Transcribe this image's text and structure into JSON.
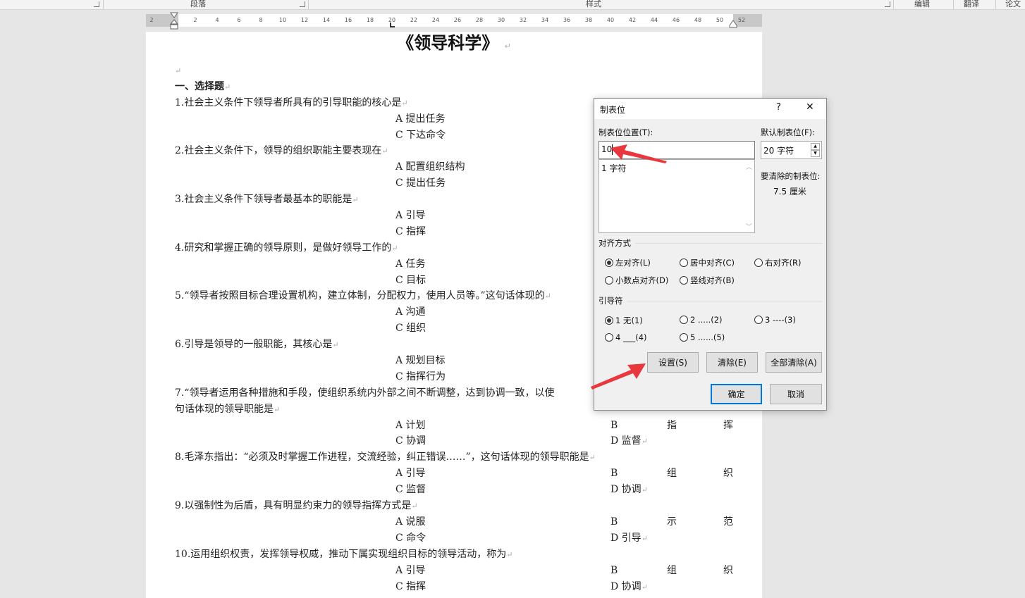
{
  "ribbon": {
    "groups": [
      "段落",
      "样式",
      "编辑",
      "翻译",
      "论文"
    ]
  },
  "ruler": {
    "left_label": "2",
    "ticks": [
      "2",
      "4",
      "6",
      "8",
      "10",
      "12",
      "14",
      "16",
      "18",
      "20",
      "22",
      "24",
      "26",
      "28",
      "30",
      "32",
      "34",
      "36",
      "38",
      "40",
      "42",
      "44",
      "46",
      "48",
      "50",
      "52"
    ]
  },
  "document": {
    "title": "《领导科学》",
    "section": "一、选择题",
    "questions": [
      {
        "text": [
          "1.社会主义条件下领导者所具有的引导职能的核心是"
        ],
        "options": [
          [
            "A 提出任务"
          ],
          [
            "C 下达命令"
          ]
        ]
      },
      {
        "text": [
          "2.社会主义条件下，领导的组织职能主要表现在"
        ],
        "options": [
          [
            "A 配置组织结构"
          ],
          [
            "C 提出任务"
          ]
        ]
      },
      {
        "text": [
          "3.社会主义条件下领导者最基本的职能是"
        ],
        "options": [
          [
            "A 引导"
          ],
          [
            "C 指挥"
          ]
        ]
      },
      {
        "text": [
          "4.研究和掌握正确的领导原则，是做好领导工作的"
        ],
        "options": [
          [
            "A 任务"
          ],
          [
            "C 目标"
          ]
        ]
      },
      {
        "text": [
          "5.“领导者按照目标合理设置机构，建立体制，分配权力，使用人员等。”这句话体现的"
        ],
        "options": [
          [
            "A 沟通"
          ],
          [
            "C 组织"
          ]
        ]
      },
      {
        "text": [
          "6.引导是领导的一般职能，其核心是"
        ],
        "options": [
          [
            "A 规划目标"
          ],
          [
            "C 指挥行为"
          ]
        ]
      },
      {
        "text": [
          "7.“领导者运用各种措施和手段，使组织系统内外部之间不断调整，达到协调一致，以使",
          "句话体现的领导职能是"
        ],
        "options": [
          [
            "A 计划",
            "B",
            "指",
            "挥"
          ],
          [
            "C 协调",
            "D 监督"
          ]
        ]
      },
      {
        "text": [
          "8.毛泽东指出：“必须及时掌握工作进程，交流经验，纠正错误……”，这句话体现的领导职能是"
        ],
        "options": [
          [
            "A 引导",
            "B",
            "组",
            "织"
          ],
          [
            "C 监督",
            "D 协调"
          ]
        ]
      },
      {
        "text": [
          "9.以强制性为后盾，具有明显约束力的领导指挥方式是"
        ],
        "options": [
          [
            "A 说服",
            "B",
            "示",
            "范"
          ],
          [
            "C 命令",
            "D 引导"
          ]
        ]
      },
      {
        "text": [
          "10.运用组织权责，发挥领导权威，推动下属实现组织目标的领导活动，称为"
        ],
        "options": [
          [
            "A 引导",
            "B",
            "组",
            "织"
          ],
          [
            "C 指挥",
            "D 协调"
          ]
        ]
      }
    ]
  },
  "dialog": {
    "title": "制表位",
    "help": "?",
    "close": "✕",
    "position_label": "制表位位置(T):",
    "position_value": "10",
    "list_items": [
      "1 字符"
    ],
    "default_label": "默认制表位(F):",
    "default_value": "20 字符",
    "clear_label": "要清除的制表位:",
    "clear_value": "7.5 厘米",
    "alignment_label": "对齐方式",
    "alignment": [
      {
        "label": "左对齐(L)",
        "checked": true
      },
      {
        "label": "居中对齐(C)"
      },
      {
        "label": "右对齐(R)"
      },
      {
        "label": "小数点对齐(D)"
      },
      {
        "label": "竖线对齐(B)"
      }
    ],
    "leader_label": "引导符",
    "leaders": [
      {
        "label": "1 无(1)",
        "checked": true
      },
      {
        "label": "2 .....(2)"
      },
      {
        "label": "3 ----(3)"
      },
      {
        "label": "4 ___(4)"
      },
      {
        "label": "5 ......(5)"
      }
    ],
    "buttons": {
      "set": "设置(S)",
      "clear": "清除(E)",
      "clear_all": "全部清除(A)",
      "ok": "确定",
      "cancel": "取消"
    }
  },
  "colors": {
    "arrow": "#e8383d",
    "ok_border": "#0078d7"
  }
}
